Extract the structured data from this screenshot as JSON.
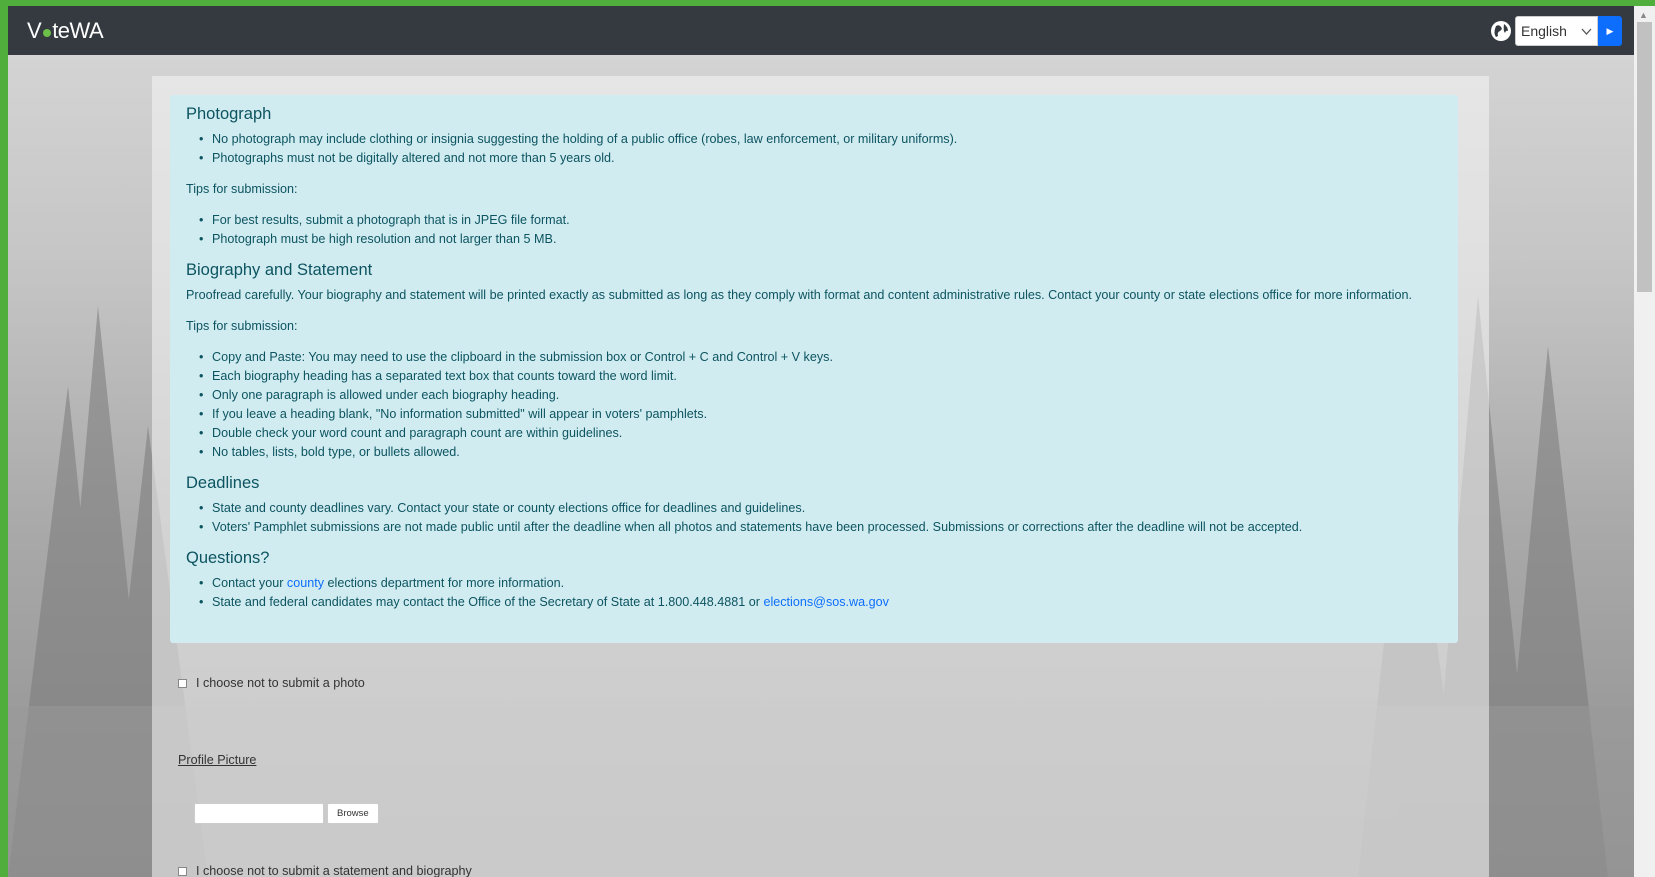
{
  "header": {
    "brand": {
      "pre": "V",
      "post": "teWA"
    },
    "language": {
      "selected": "English"
    }
  },
  "info": {
    "photograph": {
      "heading": "Photograph",
      "bullets": [
        "No photograph may include clothing or insignia suggesting the holding of a public office (robes, law enforcement, or military uniforms).",
        "Photographs must not be digitally altered and not more than 5 years old."
      ],
      "tips_label": "Tips for submission:",
      "tips": [
        "For best results, submit a photograph that is in JPEG file format.",
        "Photograph must be high resolution and not larger than 5 MB."
      ]
    },
    "biography": {
      "heading": "Biography and Statement",
      "intro": "Proofread carefully. Your biography and statement will be printed exactly as submitted as long as they comply with format and content administrative rules. Contact your county or state elections office for more information.",
      "tips_label": "Tips for submission:",
      "tips": [
        "Copy and Paste: You may need to use the clipboard in the submission box or Control + C and Control + V keys.",
        "Each biography heading has a separated text box that counts toward the word limit.",
        "Only one paragraph is allowed under each biography heading.",
        "If you leave a heading blank, \"No information submitted\" will appear in voters' pamphlets.",
        "Double check your word count and paragraph count are within guidelines.",
        "No tables, lists, bold type, or bullets allowed."
      ]
    },
    "deadlines": {
      "heading": "Deadlines",
      "bullets": [
        "State and county deadlines vary. Contact your state or county elections office for deadlines and guidelines.",
        "Voters' Pamphlet submissions are not made public until after the deadline when all photos and statements have been processed. Submissions or corrections after the deadline will not be accepted."
      ]
    },
    "questions": {
      "heading": "Questions?",
      "q1_pre": "Contact your ",
      "q1_link": "county",
      "q1_post": " elections department for more information.",
      "q2_pre": "State and federal candidates may contact the Office of the Secretary of State at 1.800.448.4881 or ",
      "q2_link": "elections@sos.wa.gov"
    }
  },
  "form": {
    "no_photo_label": "I choose not to submit a photo",
    "profile_picture_label": "Profile Picture",
    "browse_label": "Browse",
    "no_statement_label": "I choose not to submit a statement and biography"
  }
}
